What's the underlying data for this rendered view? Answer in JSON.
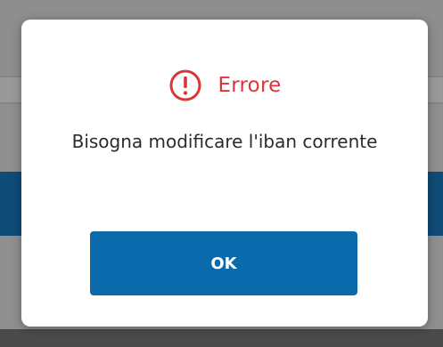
{
  "dialog": {
    "title": "Errore",
    "message": "Bisogna modificare l'iban corrente",
    "ok_label": "OK",
    "icon": "error-circle-exclamation-icon"
  },
  "colors": {
    "error": "#d9363a",
    "primary_button": "#0a6aac",
    "overlay": "#8f8f8f",
    "background_band": "#0f4c78"
  }
}
